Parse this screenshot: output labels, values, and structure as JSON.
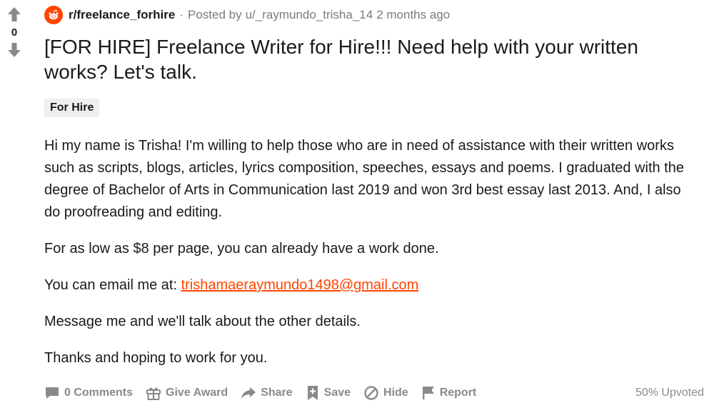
{
  "vote": {
    "count": "0",
    "upvote_icon": "arrow-up-icon",
    "downvote_icon": "arrow-down-icon"
  },
  "meta": {
    "subreddit": "r/freelance_forhire",
    "separator": "·",
    "posted_by_prefix": "Posted by",
    "author": "u/_raymundo_trisha_14",
    "time_ago": "2 months ago"
  },
  "post": {
    "title": "[FOR HIRE] Freelance Writer for Hire!!! Need help with your written works? Let's talk.",
    "flair": "For Hire",
    "paragraphs": [
      "Hi my name is Trisha! I'm willing to help those who are in need of assistance with their written works such as scripts, blogs, articles, lyrics composition, speeches, essays and poems. I graduated with the degree of Bachelor of Arts in Communication last 2019 and won 3rd best essay last 2013. And, I also do proofreading and editing.",
      "For as low as $8 per page, you can already have a work done."
    ],
    "email_prefix": "You can email me at: ",
    "email": "trishamaeraymundo1498@gmail.com",
    "closing": [
      "Message me and we'll talk about the other details.",
      "Thanks and hoping to work for you."
    ]
  },
  "actions": {
    "comments": "0 Comments",
    "give_award": "Give Award",
    "share": "Share",
    "save": "Save",
    "hide": "Hide",
    "report": "Report",
    "upvoted": "50% Upvoted"
  },
  "colors": {
    "accent": "#ff4500",
    "muted": "#878a8c",
    "text": "#1a1a1b",
    "flair_bg": "#edeff1"
  }
}
